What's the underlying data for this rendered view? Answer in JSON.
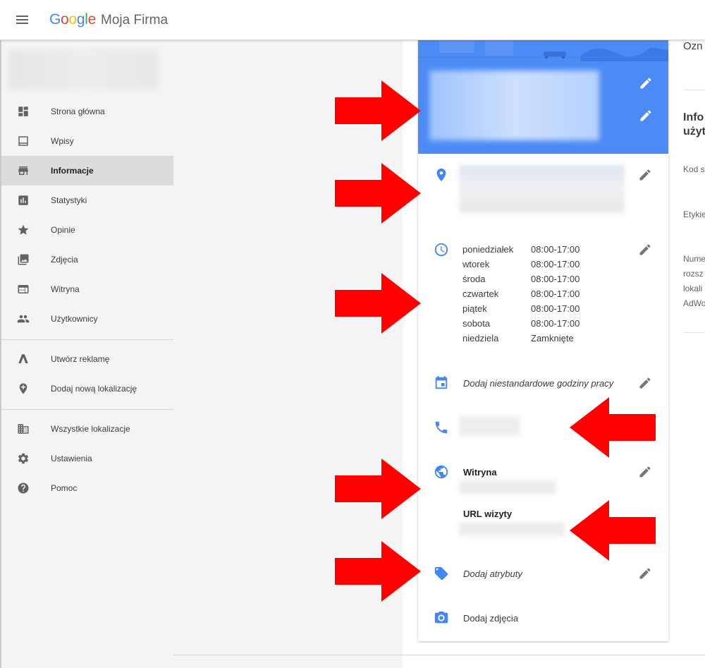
{
  "app": {
    "logo": {
      "g": "G",
      "o1": "o",
      "o2": "o",
      "g2": "g",
      "l": "l",
      "e": "e"
    },
    "product": "Moja Firma"
  },
  "sidebar": {
    "items": [
      {
        "label": "Strona główna",
        "icon": "dashboard-icon"
      },
      {
        "label": "Wpisy",
        "icon": "posts-icon"
      },
      {
        "label": "Informacje",
        "icon": "storefront-icon",
        "active": true
      },
      {
        "label": "Statystyki",
        "icon": "bar-chart-icon"
      },
      {
        "label": "Opinie",
        "icon": "star-icon"
      },
      {
        "label": "Zdjęcia",
        "icon": "photos-icon"
      },
      {
        "label": "Witryna",
        "icon": "website-icon"
      },
      {
        "label": "Użytkownicy",
        "icon": "people-icon"
      },
      {
        "label": "Utwórz reklamę",
        "icon": "adwords-icon"
      },
      {
        "label": "Dodaj nową lokalizację",
        "icon": "add-location-icon"
      },
      {
        "label": "Wszystkie lokalizacje",
        "icon": "buildings-icon"
      },
      {
        "label": "Ustawienia",
        "icon": "gear-icon"
      },
      {
        "label": "Pomoc",
        "icon": "help-icon"
      }
    ]
  },
  "card": {
    "hours": [
      {
        "day": "poniedziałek",
        "time": "08:00-17:00"
      },
      {
        "day": "wtorek",
        "time": "08:00-17:00"
      },
      {
        "day": "środa",
        "time": "08:00-17:00"
      },
      {
        "day": "czwartek",
        "time": "08:00-17:00"
      },
      {
        "day": "piątek",
        "time": "08:00-17:00"
      },
      {
        "day": "sobota",
        "time": "08:00-17:00"
      },
      {
        "day": "niedziela",
        "time": "Zamknięte"
      }
    ],
    "special_hours": "Dodaj niestandardowe godziny pracy",
    "website_label": "Witryna",
    "appointment_label": "URL wizyty",
    "attributes": "Dodaj atrybuty",
    "photos": "Dodaj zdjęcia"
  },
  "right_panel": {
    "heading_1": "Ozn",
    "heading_2_line1": "Info",
    "heading_2_line2": "użyt",
    "field_1": "Kod s",
    "field_2": "Etykie",
    "para": [
      "Nume",
      "rozsz",
      "lokali",
      "AdWo"
    ]
  },
  "colors": {
    "accent": "#4285f4",
    "header_blue": "#4c8bf5",
    "arrow_red": "#ff0000"
  }
}
